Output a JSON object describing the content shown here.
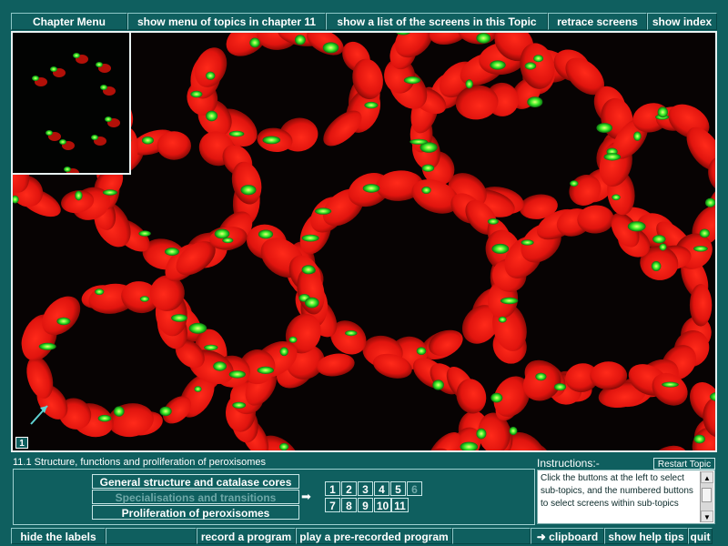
{
  "topbar": {
    "chapter_menu": "Chapter Menu",
    "topics_menu": "show menu of topics in chapter 11",
    "screens_list": "show a list of the screens in this Topic",
    "retrace": "retrace screens",
    "show_index": "show index"
  },
  "image": {
    "screen_number": "1"
  },
  "caption": "11.1 Structure, functions and proliferation of peroxisomes",
  "subtopics": [
    {
      "label": "General structure and catalase cores",
      "enabled": true
    },
    {
      "label": "Specialisations and transitions",
      "enabled": false
    },
    {
      "label": "Proliferation of peroxisomes",
      "enabled": true
    }
  ],
  "arrow": "➡",
  "screen_numbers": [
    {
      "n": "1",
      "enabled": true
    },
    {
      "n": "2",
      "enabled": true
    },
    {
      "n": "3",
      "enabled": true
    },
    {
      "n": "4",
      "enabled": true
    },
    {
      "n": "5",
      "enabled": true
    },
    {
      "n": "6",
      "enabled": false
    },
    {
      "n": "7",
      "enabled": true
    },
    {
      "n": "8",
      "enabled": true
    },
    {
      "n": "9",
      "enabled": true
    },
    {
      "n": "10",
      "enabled": true
    },
    {
      "n": "11",
      "enabled": true
    }
  ],
  "instructions": {
    "title": "Instructions:-",
    "restart": "Restart Topic",
    "text": "Click the buttons at the left to select sub-topics, and the numbered buttons to select screens within sub-topics"
  },
  "bottombar": {
    "hide_labels": "hide the labels",
    "record": "record a program",
    "play": "play a pre-recorded program",
    "clipboard": "➜ clipboard",
    "help": "show help tips",
    "quit": "quit"
  },
  "colors": {
    "panel": "#0f5f5f",
    "nuclei": "#e0140e",
    "peroxisomes": "#3ef02a"
  }
}
